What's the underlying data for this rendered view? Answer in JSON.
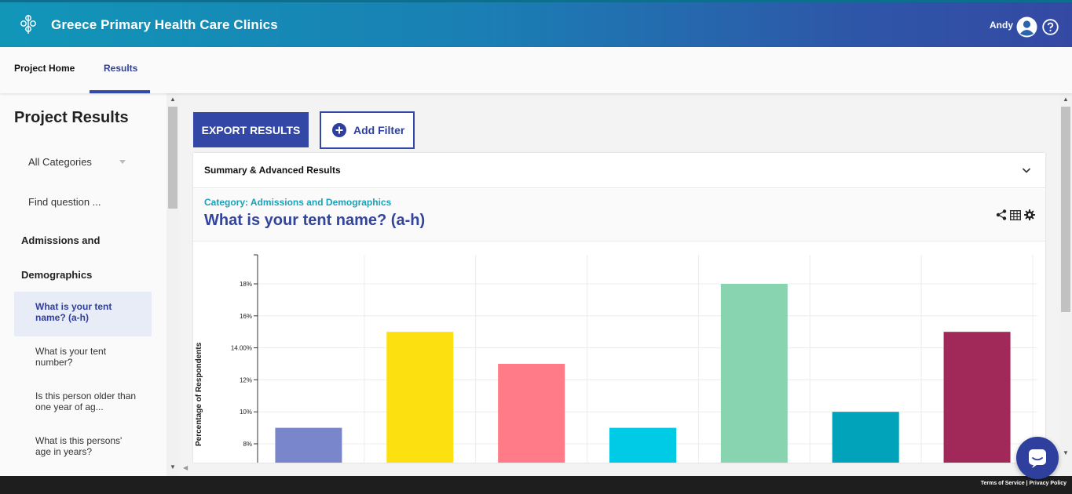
{
  "app": {
    "title": "Greece Primary Health Care Clinics",
    "user_name": "Andy",
    "brand_color": "#3348a6",
    "accent_color": "#17a2b8"
  },
  "tabs": [
    {
      "label": "Project Home",
      "active": false
    },
    {
      "label": "Results",
      "active": true
    }
  ],
  "sidebar": {
    "title": "Project Results",
    "category_select": "All Categories",
    "find_placeholder": "Find question ...",
    "category_label_line1": "Admissions and",
    "category_label_line2": "Demographics",
    "items": [
      {
        "line1": "What is your tent",
        "line2": "name? (a-h)",
        "active": true
      },
      {
        "line1": "What is your tent",
        "line2": "number?",
        "active": false
      },
      {
        "line1": "Is this person older than",
        "line2": "one year of ag...",
        "active": false
      },
      {
        "line1": "What is this persons'",
        "line2": "age in years?",
        "active": false
      }
    ]
  },
  "toolbar": {
    "export_label": "EXPORT RESULTS",
    "filter_label": "Add Filter"
  },
  "card": {
    "summary_label": "Summary & Advanced Results",
    "category": "Category: Admissions and Demographics",
    "question_title": "What is your tent name? (a-h)"
  },
  "footer": {
    "terms": "Terms of Service",
    "privacy": "Privacy Policy"
  },
  "icons": [
    "logo-icon",
    "user-icon",
    "help-icon",
    "plus-icon",
    "chevron-down-icon",
    "share-icon",
    "grid-icon",
    "gear-icon",
    "chat-icon"
  ],
  "chart_data": {
    "type": "bar",
    "categories": [
      "",
      "",
      "",
      "",
      "",
      "",
      ""
    ],
    "values": [
      9,
      15,
      13,
      9,
      18,
      10,
      15
    ],
    "colors": [
      "#7986cb",
      "#fde00f",
      "#ff7b87",
      "#00cbe6",
      "#88d4b0",
      "#00a3ba",
      "#a0295a"
    ],
    "ylabel": "Percentage of Respondents",
    "yticks": [
      {
        "value": 8,
        "label": "8%"
      },
      {
        "value": 10,
        "label": "10%"
      },
      {
        "value": 12,
        "label": "12%"
      },
      {
        "value": 14,
        "label": "14.00%"
      },
      {
        "value": 16,
        "label": "16%"
      },
      {
        "value": 18,
        "label": "18%"
      }
    ],
    "ylim_visible": [
      7,
      19
    ],
    "grid": true
  }
}
